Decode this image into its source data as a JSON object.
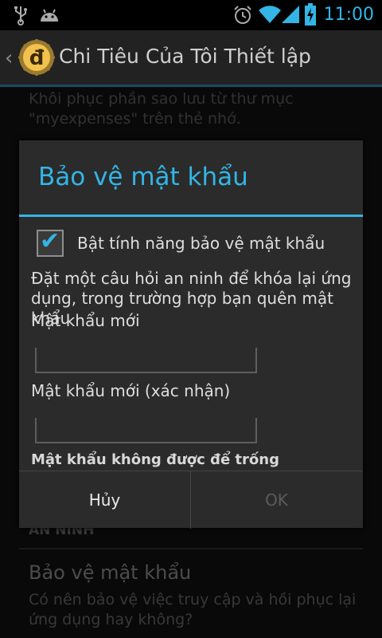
{
  "status_bar": {
    "time": "11:00",
    "icons": [
      "usb-icon",
      "android-debug-icon",
      "alarm-icon",
      "wifi-icon",
      "signal-icon",
      "battery-charging-icon"
    ],
    "accent_color": "#33b5e5"
  },
  "action_bar": {
    "title": "Chi Tiêu Của Tôi Thiết lập",
    "logo_letter": "đ"
  },
  "background": {
    "restore_summary": "Khôi phục phần sao lưu từ thư mục \"myexpenses\" trên thẻ nhớ.",
    "section_header": "AN NINH",
    "protection_title": "Bảo vệ mật khẩu",
    "protection_summary": "Có nên bảo vệ việc truy cập và hồi phục lại ứng dụng hay không?"
  },
  "dialog": {
    "title": "Bảo vệ mật khẩu",
    "checkbox_label": "Bật tính năng bảo vệ mật khẩu",
    "checkbox_checked": true,
    "description": "Đặt một câu hỏi an ninh để khóa lại ứng dụng, trong trường hợp bạn quên mật khẩu",
    "new_password_label": "Mật khẩu mới",
    "new_password_value": "",
    "confirm_password_label": "Mật khẩu mới (xác nhận)",
    "confirm_password_value": "",
    "error": "Mật khẩu không được để trống",
    "cancel_label": "Hủy",
    "ok_label": "OK"
  }
}
